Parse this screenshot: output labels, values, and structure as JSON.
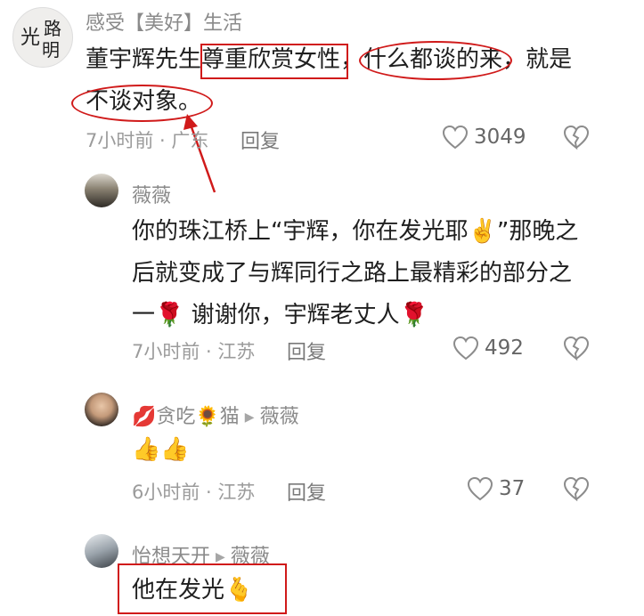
{
  "comments": [
    {
      "username": "感受【美好】生活",
      "avatar_text": "光路明",
      "text_line1": "董宇辉先生",
      "text_hl1": "尊重欣赏女性",
      "text_sep": "，",
      "text_hl2": "什么都谈的来",
      "text_tail": "，就是",
      "text_line2": "不谈对象。",
      "meta": "7小时前 · 广东",
      "reply": "回复",
      "likes": "3049"
    },
    {
      "username": "薇薇",
      "text_l1": "你的珠江桥上“宇辉，你在发光耶✌️”那晚之",
      "text_l2": "后就变成了与辉同行之路上最精彩的部分之",
      "text_l3": "一🌹 谢谢你，宇辉老丈人🌹",
      "meta": "7小时前 · 江苏",
      "reply": "回复",
      "likes": "492"
    },
    {
      "username": "💋贪吃🌻猫",
      "reply_to": "薇薇",
      "text": "👍👍",
      "meta": "6小时前 · 江苏",
      "reply": "回复",
      "likes": "37"
    },
    {
      "username": "怡想天开",
      "reply_to": "薇薇",
      "text": "他在发光🫰"
    }
  ],
  "colors": {
    "annotation": "#d01a1a",
    "muted": "#9b9b9b",
    "text": "#1f1f1f"
  },
  "icons": {
    "like": "heart-outline-icon",
    "dislike": "broken-heart-icon"
  }
}
